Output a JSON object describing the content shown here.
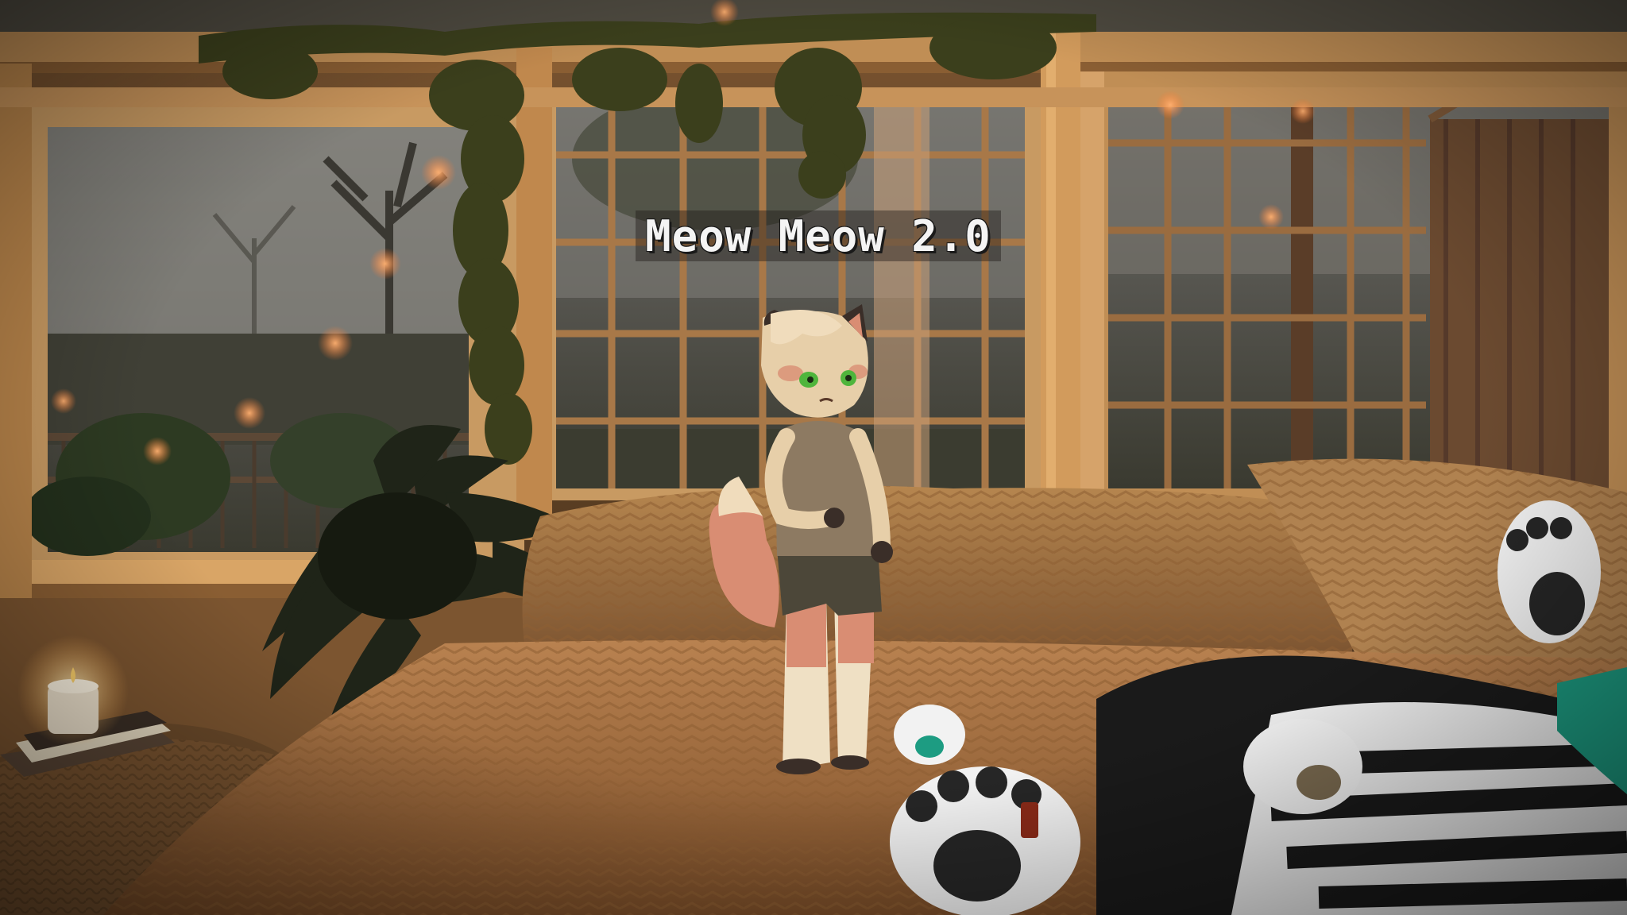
{
  "nameplate": {
    "text": "Meow Meow 2.0"
  },
  "colors": {
    "wood": "#b8844a",
    "wood_light": "#d9a566",
    "window_outside": "#5b5a55",
    "fog": "#8d8c86",
    "pillow": "#a87a45",
    "bed": "#b07844",
    "ivy": "#3b3f1c",
    "plant": "#1f2418",
    "fur_tan": "#e7cfa9",
    "fur_pink": "#d98d73",
    "shirt": "#8d7a62",
    "shorts": "#4c4739",
    "eyes": "#4fb53c"
  },
  "icons": {
    "candle": "candle-icon"
  }
}
